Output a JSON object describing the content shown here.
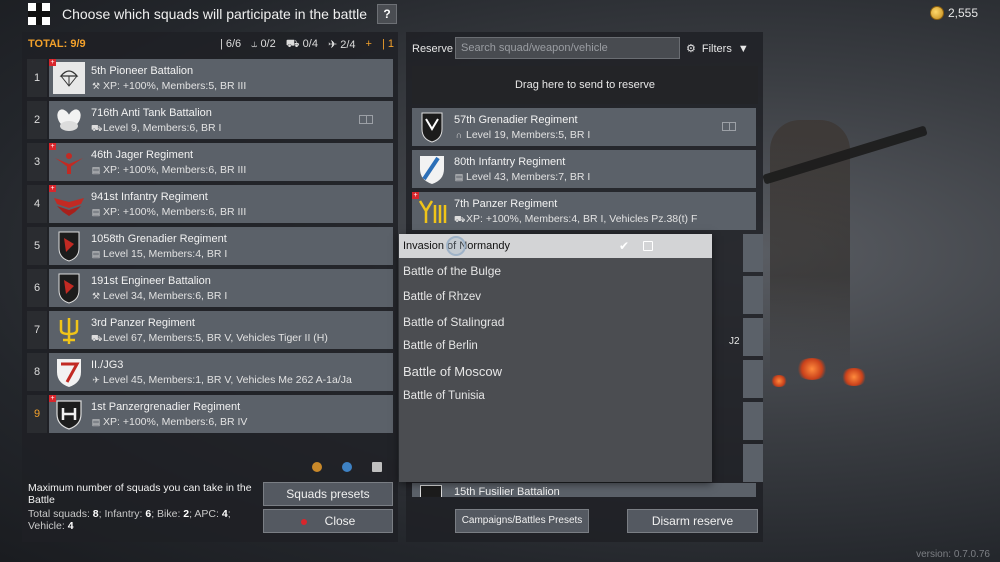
{
  "header": {
    "title": "Choose which squads will participate in the battle",
    "help_label": "?",
    "gold": "2,555"
  },
  "left": {
    "total": "TOTAL: 9/9",
    "counts": {
      "infantry": "6/6",
      "bike": "0/2",
      "apc": "0/4",
      "vehicle": "2/4",
      "plus": "+",
      "one": "1"
    },
    "squads": [
      {
        "num": "1",
        "name": "5th Pioneer Battalion",
        "meta": "XP: +100%, Members:5, BR III",
        "icon": "wrench-icon",
        "plus": true
      },
      {
        "num": "2",
        "name": "716th Anti Tank Battalion",
        "meta": "Level 9, Members:6, BR I",
        "icon": "tank-hunter-icon",
        "plus": false
      },
      {
        "num": "3",
        "name": "46th Jager Regiment",
        "meta": "XP: +100%, Members:6, BR III",
        "icon": "book-icon",
        "plus": true
      },
      {
        "num": "4",
        "name": "941st Infantry Regiment",
        "meta": "XP: +100%, Members:6, BR III",
        "icon": "book-icon",
        "plus": true
      },
      {
        "num": "5",
        "name": "1058th Grenadier Regiment",
        "meta": "Level 15, Members:4, BR I",
        "icon": "book-icon",
        "plus": false
      },
      {
        "num": "6",
        "name": "191st Engineer Battalion",
        "meta": "Level 34, Members:6, BR I",
        "icon": "wrench-icon",
        "plus": false
      },
      {
        "num": "7",
        "name": "3rd Panzer Regiment",
        "meta": "Level 67, Members:5, BR V, Vehicles Tiger II (H)",
        "icon": "tank-icon",
        "plus": false
      },
      {
        "num": "8",
        "name": "II./JG3",
        "meta": "Level 45, Members:1, BR V, Vehicles Me 262 A-1a/Ja",
        "icon": "plane-icon",
        "plus": false
      },
      {
        "num": "9",
        "name": "1st Panzergrenadier Regiment",
        "meta": "XP: +100%, Members:6, BR IV",
        "icon": "book-icon",
        "plus": true
      }
    ],
    "max_text": "Maximum number of squads you can take in the Battle",
    "totals_text": {
      "squads_label": "Total squads:",
      "squads": "8",
      "infantry_label": "Infantry:",
      "infantry": "6",
      "bike_label": "Bike:",
      "bike": "2",
      "apc_label": "APC:",
      "apc": "4",
      "vehicle_label": "Vehicle:",
      "vehicle": "4"
    },
    "presets_button": "Squads presets",
    "close_button": "Close"
  },
  "right": {
    "reserve_label": "Reserve",
    "search_placeholder": "Search squad/weapon/vehicle",
    "filters_label": "Filters",
    "drop_zone": "Drag here to send to reserve",
    "squads": [
      {
        "name": "57th Grenadier Regiment",
        "meta": "Level 19, Members:5, BR I"
      },
      {
        "name": "80th Infantry Regiment",
        "meta": "Level 43, Members:7, BR I"
      },
      {
        "name": "7th Panzer Regiment",
        "meta": "XP: +100%, Members:4, BR I, Vehicles Pz.38(t) F"
      }
    ],
    "partial_text": "J2",
    "bottom_squad": "15th Fusilier Battalion",
    "campaigns_button": "Campaigns/Battles Presets",
    "disarm_button": "Disarm reserve"
  },
  "dropdown": {
    "selected": "Invasion of Normandy",
    "options": [
      "Battle of the Bulge",
      "Battle of Rhzev",
      "Battle of Stalingrad",
      "Battle of Berlin",
      "Battle of Moscow",
      "Battle of Tunisia"
    ]
  },
  "version": "version: 0.7.0.76",
  "colors": {
    "accent": "#f3a12b",
    "badge_red": "#d8262c",
    "panel": "#5b6169"
  }
}
